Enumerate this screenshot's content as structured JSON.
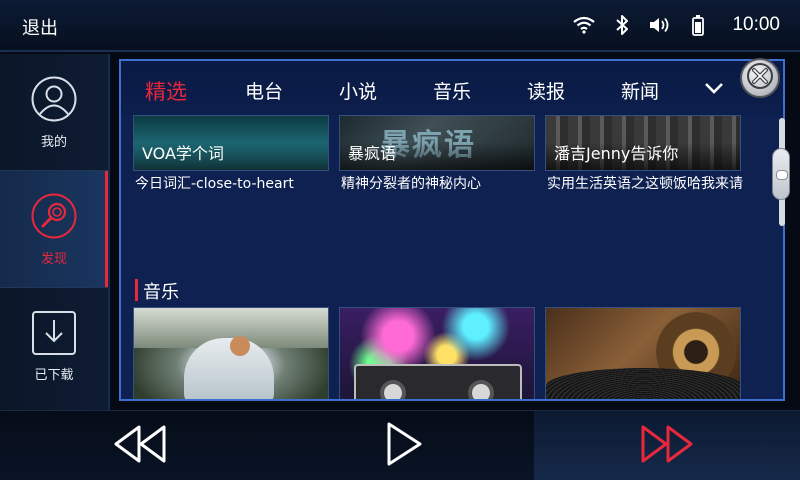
{
  "status": {
    "exit_label": "退出",
    "time": "10:00",
    "icons": [
      "wifi-icon",
      "bluetooth-icon",
      "volume-icon",
      "battery-icon"
    ]
  },
  "sidebar": {
    "items": [
      {
        "label": "我的",
        "icon": "user-icon"
      },
      {
        "label": "发现",
        "icon": "discover-icon",
        "active": true
      },
      {
        "label": "已下载",
        "icon": "download-icon"
      }
    ]
  },
  "tabs": {
    "items": [
      "精选",
      "电台",
      "小说",
      "音乐",
      "读报",
      "新闻"
    ],
    "active": "精选",
    "accent": "#e8283c"
  },
  "cards_row1": [
    {
      "overlay": "VOA学个词",
      "title": "今日词汇-close-to-heart"
    },
    {
      "overlay": "暴疯语",
      "poster_text": "暴疯语",
      "title": "精神分裂者的神秘内心"
    },
    {
      "overlay": "潘吉Jenny告诉你",
      "title": "实用生活英语之这顿饭哈我来请"
    }
  ],
  "music_section": {
    "title": "音乐",
    "cards": [
      {
        "image": "woman-sitting-on-bench"
      },
      {
        "image": "cassette-tape-with-lights"
      },
      {
        "image": "gramophone-vinyl"
      }
    ]
  },
  "controls": [
    "rewind-button",
    "play-button",
    "fast-forward-button"
  ]
}
